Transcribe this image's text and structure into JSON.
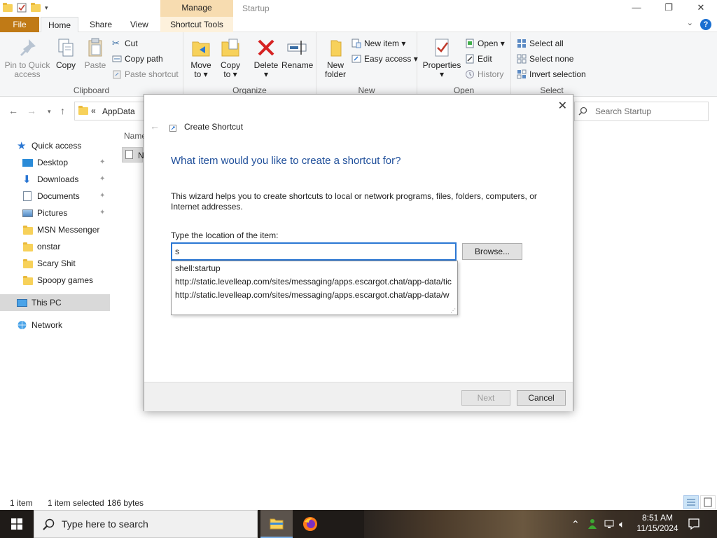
{
  "window": {
    "title": "Startup",
    "contextual_tab_group": "Manage",
    "minimize": "—",
    "maximize": "❐",
    "close": "✕"
  },
  "ribbon_tabs": {
    "file": "File",
    "home": "Home",
    "share": "Share",
    "view": "View",
    "shortcut_tools": "Shortcut Tools"
  },
  "ribbon": {
    "clipboard": {
      "label": "Clipboard",
      "pin_line1": "Pin to Quick",
      "pin_line2": "access",
      "copy": "Copy",
      "paste": "Paste",
      "cut": "Cut",
      "copy_path": "Copy path",
      "paste_shortcut": "Paste shortcut"
    },
    "organize": {
      "label": "Organize",
      "move_line1": "Move",
      "move_line2": "to ▾",
      "copy_line1": "Copy",
      "copy_line2": "to ▾",
      "delete_line1": "Delete",
      "delete_line2": "▾",
      "rename": "Rename"
    },
    "new": {
      "label": "New",
      "folder_line1": "New",
      "folder_line2": "folder",
      "new_item": "New item ▾",
      "easy_access": "Easy access ▾"
    },
    "open": {
      "label": "Open",
      "properties_line1": "Properties",
      "properties_line2": "▾",
      "open": "Open ▾",
      "edit": "Edit",
      "history": "History"
    },
    "select": {
      "label": "Select",
      "select_all": "Select all",
      "select_none": "Select none",
      "invert": "Invert selection"
    }
  },
  "address": {
    "prefix": "«",
    "path": "AppData",
    "search_placeholder": "Search Startup"
  },
  "nav": {
    "quick_access": "Quick access",
    "items": [
      {
        "label": "Desktop",
        "pinned": "✦"
      },
      {
        "label": "Downloads",
        "pinned": "✦"
      },
      {
        "label": "Documents",
        "pinned": "✦"
      },
      {
        "label": "Pictures",
        "pinned": "✦"
      },
      {
        "label": "MSN Messenger"
      },
      {
        "label": "onstar"
      },
      {
        "label": "Scary Shit"
      },
      {
        "label": "Spoopy games"
      }
    ],
    "this_pc": "This PC",
    "network": "Network"
  },
  "filelist": {
    "column_name": "Name",
    "row_fragment": "N"
  },
  "status": {
    "count": "1 item",
    "selected": "1 item selected",
    "size": "186 bytes"
  },
  "dialog": {
    "close": "✕",
    "back": "←",
    "title": "Create Shortcut",
    "heading": "What item would you like to create a shortcut for?",
    "description": "This wizard helps you to create shortcuts to local or network programs, files, folders, computers, or Internet addresses.",
    "location_label": "Type the location of the item:",
    "location_value": "s",
    "browse": "Browse...",
    "autocomplete": [
      "shell:startup",
      "http://static.levelleap.com/sites/messaging/apps.escargot.chat/app-data/tic",
      "http://static.levelleap.com/sites/messaging/apps.escargot.chat/app-data/w"
    ],
    "next": "Next",
    "cancel": "Cancel"
  },
  "taskbar": {
    "search_placeholder": "Type here to search",
    "time": "8:51 AM",
    "date": "11/15/2024"
  },
  "colors": {
    "accent": "#2b77d3",
    "heading_blue": "#1e4e9a",
    "file_tab": "#c07a16",
    "manage_tab": "#f7dcb0"
  }
}
